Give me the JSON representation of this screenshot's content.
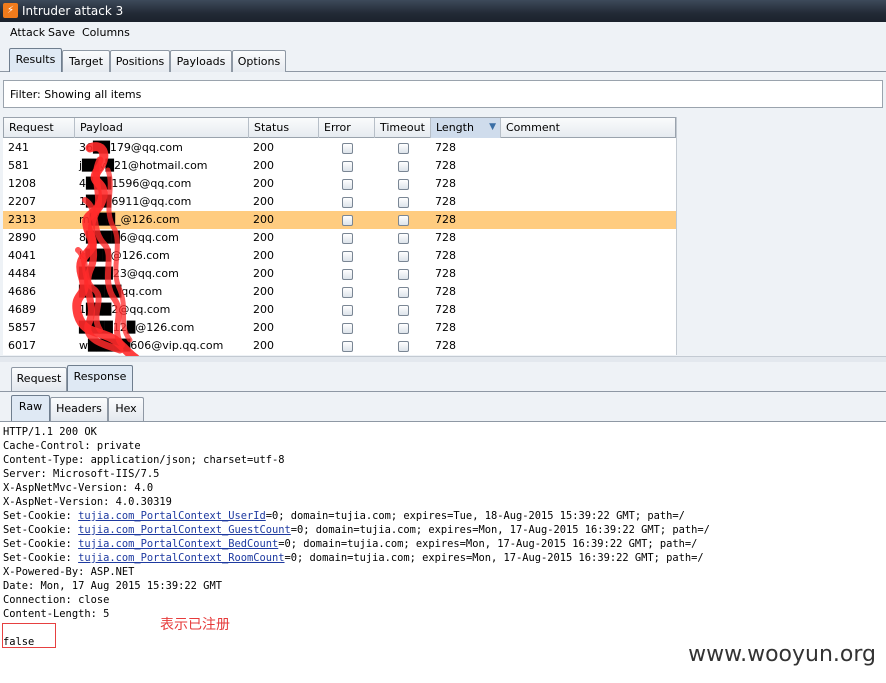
{
  "window": {
    "title": "Intruder attack 3"
  },
  "menu": [
    "Attack",
    "Save",
    "Columns"
  ],
  "main_tabs": [
    "Results",
    "Target",
    "Positions",
    "Payloads",
    "Options"
  ],
  "filter": {
    "text": "Filter:  Showing all items"
  },
  "table": {
    "columns": [
      "Request",
      "Payload",
      "Status",
      "Error",
      "Timeout",
      "Length",
      "Comment"
    ],
    "rows": [
      {
        "request": "241",
        "payload": "36██179@qq.com",
        "status": "200",
        "length": "728"
      },
      {
        "request": "581",
        "payload": "j██y█21@hotmail.com",
        "status": "200",
        "length": "728"
      },
      {
        "request": "1208",
        "payload": "4███1596@qq.com",
        "status": "200",
        "length": "728"
      },
      {
        "request": "2207",
        "payload": "1███6911@qq.com",
        "status": "200",
        "length": "728"
      },
      {
        "request": "2313",
        "payload": "m███_@126.com",
        "status": "200",
        "length": "728"
      },
      {
        "request": "2890",
        "payload": "8████6@qq.com",
        "status": "200",
        "length": "728"
      },
      {
        "request": "4041",
        "payload": "k███@126.com",
        "status": "200",
        "length": "728"
      },
      {
        "request": "4484",
        "payload": "████23@qq.com",
        "status": "200",
        "length": "728"
      },
      {
        "request": "4686",
        "payload": "█████qq.com",
        "status": "200",
        "length": "728"
      },
      {
        "request": "4689",
        "payload": "1███2@qq.com",
        "status": "200",
        "length": "728"
      },
      {
        "request": "5857",
        "payload": "████12█@126.com",
        "status": "200",
        "length": "728"
      },
      {
        "request": "6017",
        "payload": "w█████606@vip.qq.com",
        "status": "200",
        "length": "728"
      }
    ],
    "selected_index": 4
  },
  "sub_tabs": [
    "Request",
    "Response"
  ],
  "view_tabs": [
    "Raw",
    "Headers",
    "Hex"
  ],
  "response": {
    "lines": [
      "HTTP/1.1 200 OK",
      "Cache-Control: private",
      "Content-Type: application/json; charset=utf-8",
      "Server: Microsoft-IIS/7.5",
      "X-AspNetMvc-Version: 4.0",
      "X-AspNet-Version: 4.0.30319"
    ],
    "cookies": [
      {
        "prefix": "Set-Cookie: ",
        "name": "tujia.com_PortalContext_UserId",
        "rest": "=0; domain=tujia.com; expires=Tue, 18-Aug-2015 15:39:22 GMT; path=/"
      },
      {
        "prefix": "Set-Cookie: ",
        "name": "tujia.com_PortalContext_GuestCount",
        "rest": "=0; domain=tujia.com; expires=Mon, 17-Aug-2015 16:39:22 GMT; path=/"
      },
      {
        "prefix": "Set-Cookie: ",
        "name": "tujia.com_PortalContext_BedCount",
        "rest": "=0; domain=tujia.com; expires=Mon, 17-Aug-2015 16:39:22 GMT; path=/"
      },
      {
        "prefix": "Set-Cookie: ",
        "name": "tujia.com_PortalContext_RoomCount",
        "rest": "=0; domain=tujia.com; expires=Mon, 17-Aug-2015 16:39:22 GMT; path=/"
      }
    ],
    "tail_lines": [
      "X-Powered-By: ASP.NET",
      "Date: Mon, 17 Aug 2015 15:39:22 GMT",
      "Connection: close",
      "Content-Length: 5"
    ],
    "body": "false"
  },
  "annotation": "表示已注册",
  "watermark": "www.wooyun.org",
  "colors": {
    "selected_row": "#ffcc80",
    "annotation": "#e63a3a",
    "redaction": "#ff2a2a"
  }
}
